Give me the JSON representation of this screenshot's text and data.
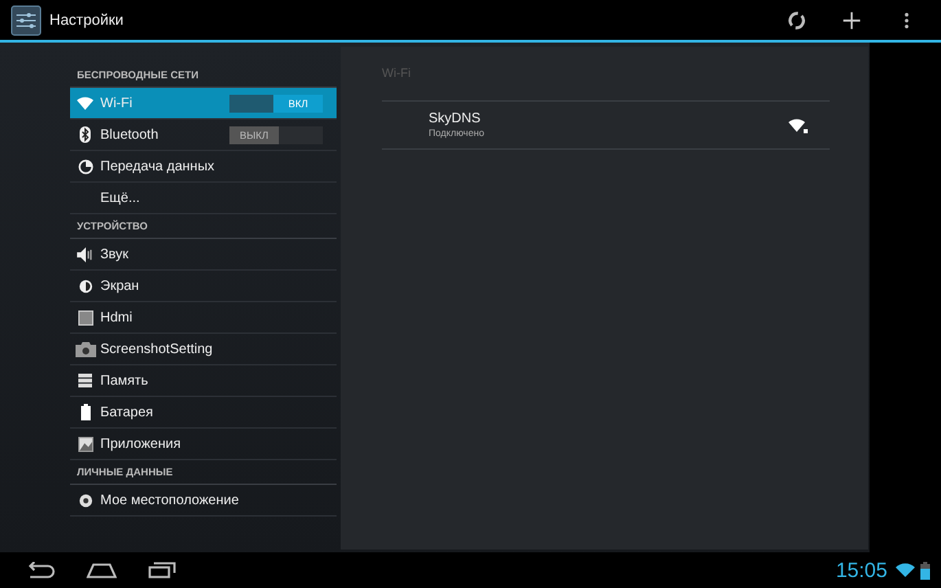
{
  "action_bar": {
    "title": "Настройки"
  },
  "sidebar": {
    "sections": [
      {
        "header": "БЕСПРОВОДНЫЕ СЕТИ",
        "items": [
          {
            "label": "Wi-Fi",
            "kind": "wifi",
            "selected": true,
            "toggle": {
              "label": "ВКЛ",
              "on": true
            }
          },
          {
            "label": "Bluetooth",
            "kind": "bluetooth",
            "selected": false,
            "toggle": {
              "label": "ВЫКЛ",
              "on": false
            }
          },
          {
            "label": "Передача данных",
            "kind": "data",
            "selected": false
          },
          {
            "label": "Ещё...",
            "kind": "plain",
            "selected": false
          }
        ]
      },
      {
        "header": "УСТРОЙСТВО",
        "items": [
          {
            "label": "Звук",
            "kind": "sound",
            "selected": false
          },
          {
            "label": "Экран",
            "kind": "display",
            "selected": false
          },
          {
            "label": "Hdmi",
            "kind": "hdmi",
            "selected": false
          },
          {
            "label": "ScreenshotSetting",
            "kind": "camera",
            "selected": false
          },
          {
            "label": "Память",
            "kind": "storage",
            "selected": false
          },
          {
            "label": "Батарея",
            "kind": "battery",
            "selected": false
          },
          {
            "label": "Приложения",
            "kind": "apps",
            "selected": false
          }
        ]
      },
      {
        "header": "ЛИЧНЫЕ ДАННЫЕ",
        "items": [
          {
            "label": "Мое местоположение",
            "kind": "location",
            "selected": false
          }
        ]
      }
    ]
  },
  "detail": {
    "title": "Wi-Fi",
    "networks": [
      {
        "name": "SkyDNS",
        "status": "Подключено"
      }
    ]
  },
  "status_bar": {
    "time": "15:05"
  }
}
